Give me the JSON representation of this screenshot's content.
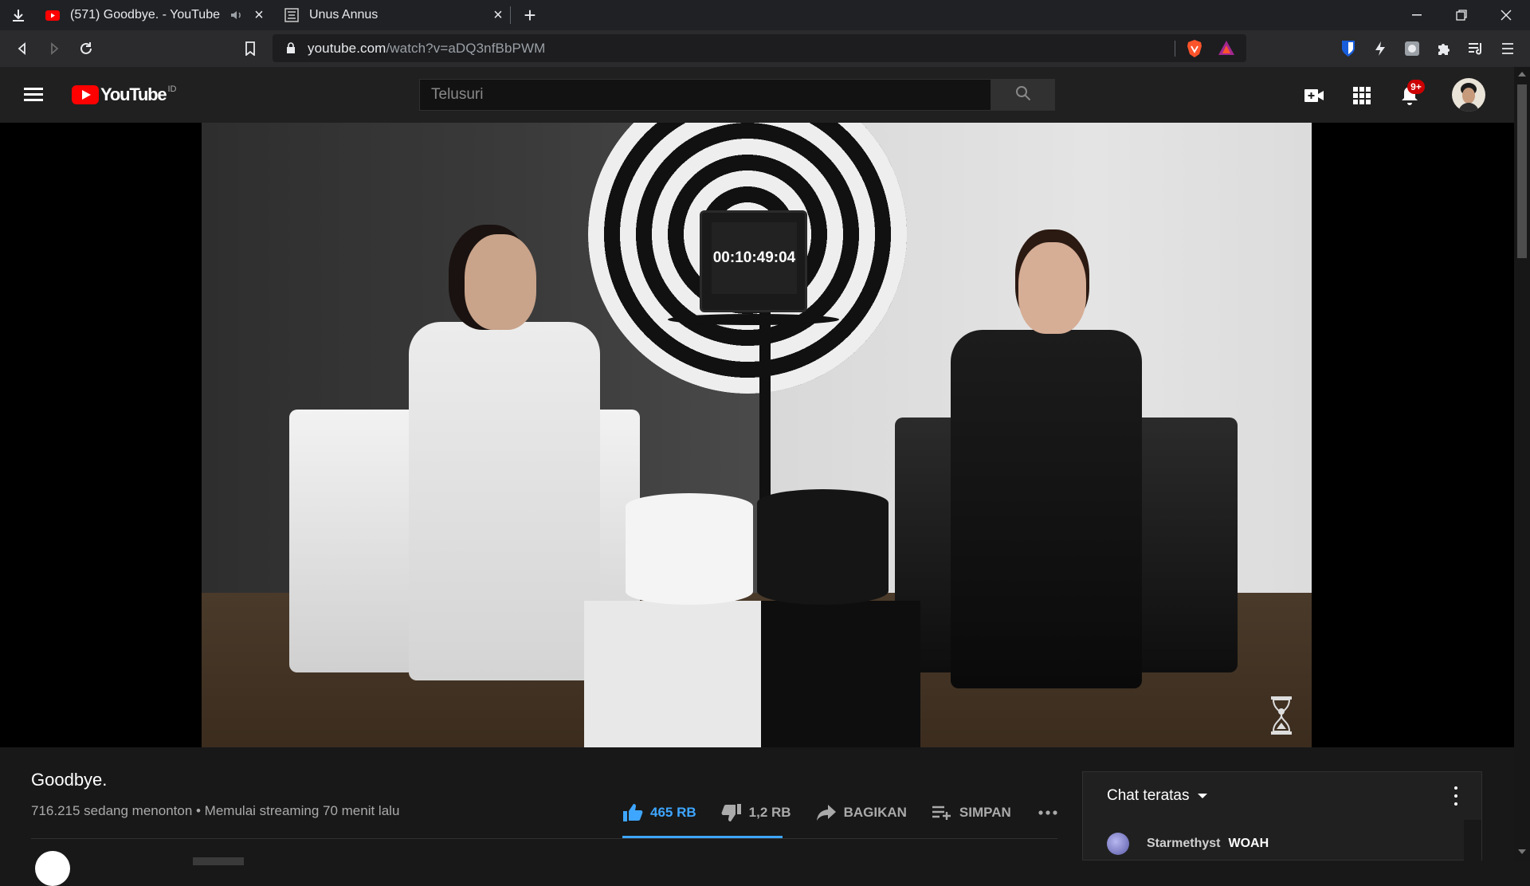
{
  "browser": {
    "tabs": [
      {
        "title": "(571) Goodbye. - YouTube",
        "active": true,
        "muted_indicator": "speaker-icon"
      },
      {
        "title": "Unus Annus",
        "active": false
      }
    ],
    "new_tab": "+",
    "url": {
      "host": "youtube.com",
      "path": "/watch?v=aDQ3nfBbPWM"
    }
  },
  "masthead": {
    "logo_text": "YouTube",
    "region": "ID",
    "search_placeholder": "Telusuri",
    "notification_count": "9+"
  },
  "player": {
    "tv_timer": "00:10:49:04"
  },
  "video": {
    "title": "Goodbye.",
    "meta": "716.215 sedang menonton • Memulai streaming 70 menit lalu",
    "likes": "465 RB",
    "dislikes": "1,2 RB",
    "share_label": "BAGIKAN",
    "save_label": "SIMPAN",
    "like_ratio": 1.0
  },
  "chat": {
    "mode_label": "Chat teratas",
    "messages": [
      {
        "author": "Starmethyst",
        "text": "WOAH"
      }
    ]
  },
  "colors": {
    "accent_blue": "#3ea6ff",
    "yt_red": "#ff0000",
    "bg": "#181818"
  }
}
